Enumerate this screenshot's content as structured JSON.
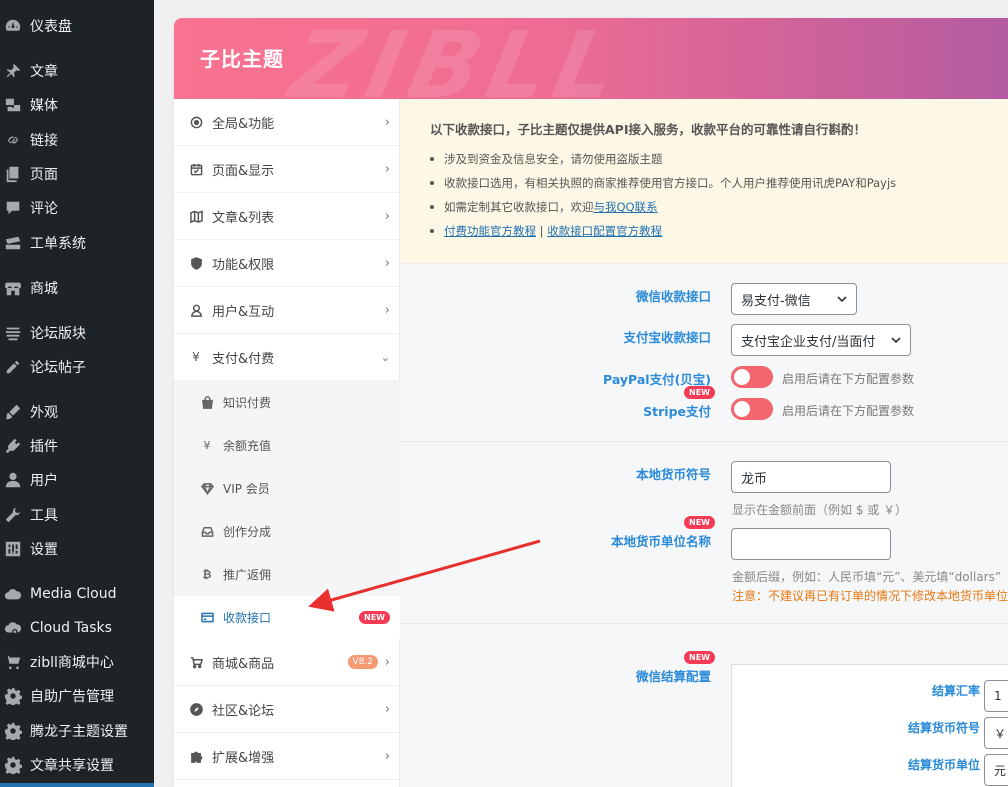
{
  "wp_menu": [
    {
      "label": "仪表盘",
      "icon": "dashboard-icon"
    },
    {
      "label": "文章",
      "icon": "pin-icon"
    },
    {
      "label": "媒体",
      "icon": "media-icon"
    },
    {
      "label": "链接",
      "icon": "link-icon"
    },
    {
      "label": "页面",
      "icon": "page-icon"
    },
    {
      "label": "评论",
      "icon": "comment-icon"
    },
    {
      "label": "工单系统",
      "icon": "ticket-icon"
    },
    {
      "label": "商城",
      "icon": "store-icon"
    },
    {
      "label": "论坛版块",
      "icon": "forum-icon"
    },
    {
      "label": "论坛帖子",
      "icon": "post-icon"
    },
    {
      "label": "外观",
      "icon": "brush-icon"
    },
    {
      "label": "插件",
      "icon": "plugin-icon"
    },
    {
      "label": "用户",
      "icon": "user-icon"
    },
    {
      "label": "工具",
      "icon": "wrench-icon"
    },
    {
      "label": "设置",
      "icon": "settings-icon"
    },
    {
      "label": "Media Cloud",
      "icon": "cloud-icon"
    },
    {
      "label": "Cloud Tasks",
      "icon": "cloud-gear-icon"
    },
    {
      "label": "zibll商城中心",
      "icon": "cart-icon"
    },
    {
      "label": "自助广告管理",
      "icon": "gear-icon"
    },
    {
      "label": "腾龙子主题设置",
      "icon": "gear-icon"
    },
    {
      "label": "文章共享设置",
      "icon": "gear-icon"
    }
  ],
  "panel": {
    "title": "子比主题",
    "watermark": "ZIBLL"
  },
  "settings_nav": {
    "items": [
      {
        "label": "全局&功能",
        "icon": "target-icon"
      },
      {
        "label": "页面&显示",
        "icon": "calendar-icon"
      },
      {
        "label": "文章&列表",
        "icon": "map-icon"
      },
      {
        "label": "功能&权限",
        "icon": "shield-icon"
      },
      {
        "label": "用户&互动",
        "icon": "user-outline-icon"
      },
      {
        "label": "支付&付费",
        "icon": "yen-icon",
        "expanded": true
      }
    ],
    "sub_items": [
      {
        "label": "知识付费",
        "icon": "bag-icon"
      },
      {
        "label": "余额充值",
        "icon": "yen-icon"
      },
      {
        "label": "VIP 会员",
        "icon": "diamond-icon"
      },
      {
        "label": "创作分成",
        "icon": "inbox-icon"
      },
      {
        "label": "推广返佣",
        "icon": "bitcoin-icon"
      },
      {
        "label": "收款接口",
        "icon": "card-icon",
        "badge": "NEW",
        "active": true
      }
    ],
    "items_after": [
      {
        "label": "商城&商品",
        "icon": "cart-icon",
        "badge": "V8.2"
      },
      {
        "label": "社区&论坛",
        "icon": "compass-icon"
      },
      {
        "label": "扩展&增强",
        "icon": "puzzle-icon"
      }
    ]
  },
  "notice": {
    "title": "以下收款接口，子比主题仅提供API接入服务，收款平台的可靠性请自行斟酌！",
    "line1": "涉及到资金及信息安全，请勿使用盗版主题",
    "line2": "收款接口选用，有相关执照的商家推荐使用官方接口。个人用户推荐使用讯虎PAY和Payjs",
    "line3_prefix": "如需定制其它收款接口，欢迎",
    "line3_link": "与我QQ联系",
    "line4_link1": "付费功能官方教程",
    "line4_sep": " | ",
    "line4_link2": "收款接口配置官方教程"
  },
  "payment": {
    "wechat_label": "微信收款接口",
    "wechat_value": "易支付-微信",
    "alipay_label": "支付宝收款接口",
    "alipay_value": "支付宝企业支付/当面付",
    "paypal_label": "PayPal支付(贝宝)",
    "paypal_hint": "启用后请在下方配置参数",
    "stripe_label": "Stripe支付",
    "stripe_badge": "NEW",
    "stripe_hint": "启用后请在下方配置参数"
  },
  "currency": {
    "symbol_label": "本地货币符号",
    "symbol_value": "龙币",
    "symbol_help": "显示在金额前面（例如 $ 或 ￥）",
    "unit_label": "本地货币单位名称",
    "unit_badge": "NEW",
    "unit_value": "",
    "unit_help": "金额后缀，例如：人民币填“元”、美元填“dollars”",
    "unit_warn": "注意：不建议再已有订单的情况下修改本地货币单位"
  },
  "wechat_settlement": {
    "label": "微信结算配置",
    "badge": "NEW",
    "rate_label": "结算汇率",
    "rate_value": "1",
    "symbol_label": "结算货币符号",
    "symbol_value": "￥",
    "unit_label": "结算货币单位",
    "unit_value": "元"
  },
  "colors": {
    "wp_sidebar_bg": "#1d2327",
    "header_gradient_start": "#f9728f",
    "header_gradient_end": "#b25ca2",
    "label_blue": "#2c8bd9",
    "toggle_on": "#f3666e",
    "badge_red": "#f33b56",
    "warning_orange": "#e8770f",
    "arrow_red": "#e8302f"
  }
}
